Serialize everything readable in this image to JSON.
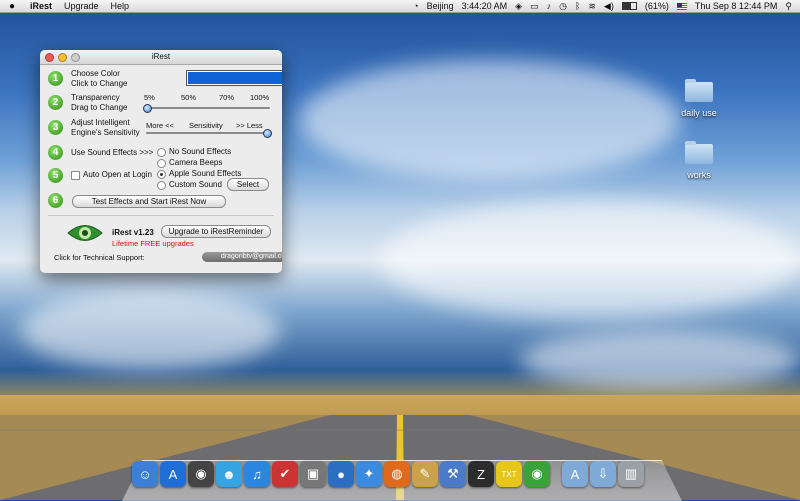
{
  "menubar": {
    "app_name": "iRest",
    "menus": [
      "Upgrade",
      "Help"
    ],
    "clock_city": "Beijing",
    "clock_time": "3:44:20 AM",
    "battery": "(61%)",
    "datetime": "Thu Sep 8  12:44 PM"
  },
  "desktop": {
    "folders": [
      {
        "label": "daily use"
      },
      {
        "label": "works"
      }
    ]
  },
  "window": {
    "title": "iRest",
    "rows": {
      "color": {
        "number": "1",
        "line1": "Choose Color",
        "line2": "Click to Change",
        "swatch_color": "#0f63d6"
      },
      "transparency": {
        "number": "2",
        "line1": "Transparency",
        "line2": "Drag to Change",
        "ticks": [
          "5%",
          "50%",
          "70%",
          "100%"
        ],
        "value_percent": 5
      },
      "sensitivity": {
        "number": "3",
        "line1": "Adjust Intelligent",
        "line2": "Engine's Sensitivity",
        "more": "More <<",
        "mid": "Sensitivity",
        "less": ">> Less",
        "value_fraction": 1.0
      },
      "sound": {
        "number": "4",
        "label": "Use Sound Effects  >>>",
        "options": [
          "No Sound Effects",
          "Camera Beeps",
          "Apple Sound Effects",
          "Custom Sound"
        ],
        "selected": "Apple Sound Effects",
        "select_button": "Select"
      },
      "login": {
        "number": "5",
        "label": "Auto Open at Login",
        "checked": false
      },
      "test": {
        "number": "6",
        "button": "Test Effects and Start iRest Now"
      }
    },
    "footer": {
      "version": "iRest  v1.23",
      "upgrade_button": "Upgrade to iRestReminder",
      "promo": "Lifetime FREE upgrades",
      "support_label": "Click for Technical Support:",
      "support_email": "dragonbtv@gmail.com"
    }
  },
  "dock": {
    "items": [
      {
        "icon": "finder-icon",
        "glyph": "☺",
        "color": "#3d7fd6"
      },
      {
        "icon": "app-store-icon",
        "glyph": "A",
        "color": "#1f6ed8"
      },
      {
        "icon": "dashboard-icon",
        "glyph": "◉",
        "color": "#444"
      },
      {
        "icon": "messenger-icon",
        "glyph": "☻",
        "color": "#36a3e3"
      },
      {
        "icon": "itunes-icon",
        "glyph": "♫",
        "color": "#2a86e0"
      },
      {
        "icon": "calendar-app-icon",
        "glyph": "✔",
        "color": "#c33"
      },
      {
        "icon": "preview-icon",
        "glyph": "▣",
        "color": "#777"
      },
      {
        "icon": "google-earth-icon",
        "glyph": "●",
        "color": "#2a6fc0"
      },
      {
        "icon": "safari-icon",
        "glyph": "✦",
        "color": "#3c8be0"
      },
      {
        "icon": "firefox-icon",
        "glyph": "◍",
        "color": "#e06a1c"
      },
      {
        "icon": "textedit-icon",
        "glyph": "✎",
        "color": "#c9a24b"
      },
      {
        "icon": "xcode-icon",
        "glyph": "⚒",
        "color": "#4a7ac8"
      },
      {
        "icon": "zoom-app-icon",
        "glyph": "Z",
        "color": "#2c2c2c"
      },
      {
        "icon": "txt-app-icon",
        "glyph": "TXT",
        "color": "#e6c619"
      },
      {
        "icon": "irest-eye-icon",
        "glyph": "◉",
        "color": "#3aa23a"
      },
      {
        "icon": "applications-folder-icon",
        "glyph": "A",
        "color": "#7fa9d6"
      },
      {
        "icon": "downloads-folder-icon",
        "glyph": "⇩",
        "color": "#7fa9d6"
      },
      {
        "icon": "trash-icon",
        "glyph": "▥",
        "color": "#9aa0a6"
      }
    ]
  }
}
